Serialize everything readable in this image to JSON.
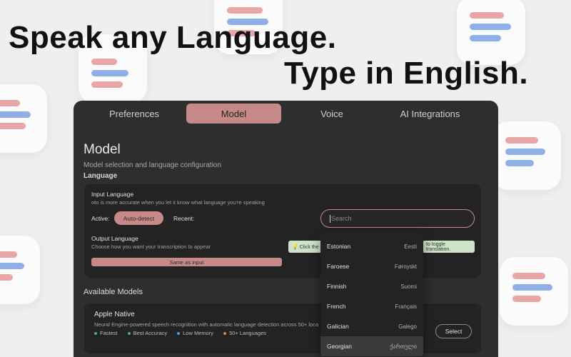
{
  "headline": {
    "line1": "Speak any Language.",
    "line2": "Type in English."
  },
  "tabs": [
    {
      "label": "Preferences",
      "active": false
    },
    {
      "label": "Model",
      "active": true
    },
    {
      "label": "Voice",
      "active": false
    },
    {
      "label": "AI Integrations",
      "active": false
    }
  ],
  "page": {
    "title": "Model",
    "subtitle": "Model selection and language configuration",
    "section": "Language"
  },
  "input_language": {
    "label": "Input Language",
    "description": "oto is more accurate when you let it know what language you're speaking",
    "active_label": "Active:",
    "active_value": "Auto-detect",
    "recent_label": "Recent:",
    "search_placeholder": "Search"
  },
  "output_language": {
    "label": "Output Language",
    "description": "Choose how you want your transcription to appear",
    "hint_left": "💡 Click the",
    "hint_right": "to toggle translation.",
    "same_as_input": "Same as input"
  },
  "available_models": {
    "heading": "Available Models",
    "models": [
      {
        "name": "Apple Native",
        "description": "Neural Engine-powered speech recognition with automatic language detection across 50+ loca",
        "select_label": "Select",
        "tags": [
          {
            "label": "Fastest",
            "color": "#4caf78"
          },
          {
            "label": "Best Accuracy",
            "color": "#4caf78"
          },
          {
            "label": "Low Memory",
            "color": "#4aa3d8"
          },
          {
            "label": "50+ Languages",
            "color": "#e08a3a"
          }
        ]
      }
    ]
  },
  "language_dropdown": [
    {
      "english": "Estonian",
      "native": "Eesti"
    },
    {
      "english": "Faroese",
      "native": "Føroyskt"
    },
    {
      "english": "Finnish",
      "native": "Suomi"
    },
    {
      "english": "French",
      "native": "Français"
    },
    {
      "english": "Galician",
      "native": "Galego"
    },
    {
      "english": "Georgian",
      "native": "ქართული"
    }
  ],
  "colors": {
    "accent": "#c58a87",
    "window_bg": "#2e2e2f",
    "card_bg": "#232324",
    "hint_bg": "#cfe3c9"
  }
}
